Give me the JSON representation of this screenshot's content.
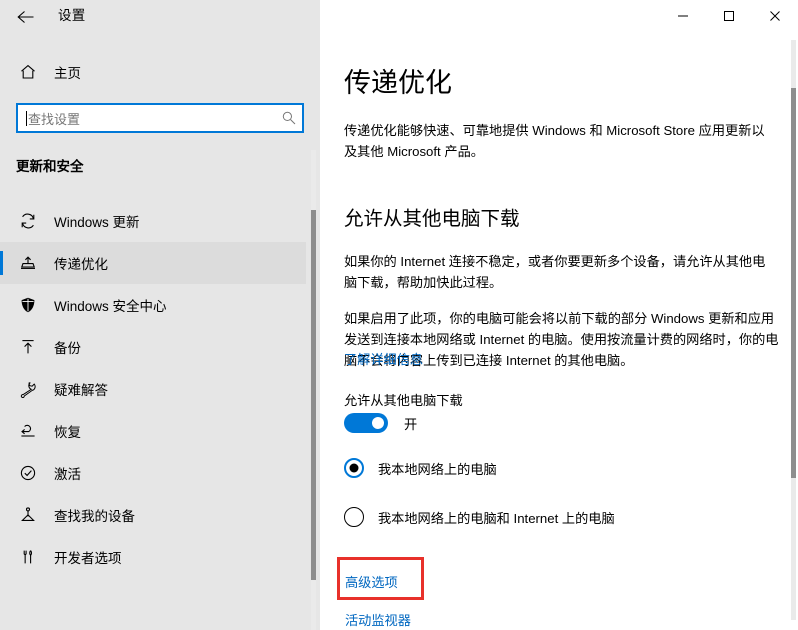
{
  "window": {
    "app_title": "设置",
    "back_icon": "back-arrow-icon",
    "minimize_label": "最小化",
    "maximize_label": "最大化",
    "close_label": "关闭"
  },
  "sidebar": {
    "home": {
      "label": "主页",
      "icon": "home-icon"
    },
    "search": {
      "placeholder": "查找设置",
      "value": "",
      "icon": "search-icon"
    },
    "group_heading": "更新和安全",
    "items": [
      {
        "label": "Windows 更新",
        "icon": "sync-icon",
        "selected": false
      },
      {
        "label": "传递优化",
        "icon": "delivery-optimization-icon",
        "selected": true
      },
      {
        "label": "Windows 安全中心",
        "icon": "shield-icon",
        "selected": false
      },
      {
        "label": "备份",
        "icon": "backup-upload-icon",
        "selected": false
      },
      {
        "label": "疑难解答",
        "icon": "wrench-icon",
        "selected": false
      },
      {
        "label": "恢复",
        "icon": "recovery-icon",
        "selected": false
      },
      {
        "label": "激活",
        "icon": "check-circle-icon",
        "selected": false
      },
      {
        "label": "查找我的设备",
        "icon": "find-device-icon",
        "selected": false
      },
      {
        "label": "开发者选项",
        "icon": "developer-tools-icon",
        "selected": false
      }
    ]
  },
  "main": {
    "page_title": "传递优化",
    "intro": "传递优化能够快速、可靠地提供 Windows 和 Microsoft Store 应用更新以及其他 Microsoft 产品。",
    "section_title": "允许从其他电脑下载",
    "paragraph_1": "如果你的 Internet 连接不稳定，或者你要更新多个设备，请允许从其他电脑下载，帮助加快此过程。",
    "paragraph_2": "如果启用了此项，你的电脑可能会将以前下载的部分 Windows 更新和应用发送到连接本地网络或 Internet 的电脑。使用按流量计费的网络时，你的电脑不会将内容上传到已连接 Internet 的其他电脑。",
    "learn_more_label": "了解详细信息",
    "toggle": {
      "label": "允许从其他电脑下载",
      "state_label": "开",
      "on": true
    },
    "radios": [
      {
        "label": "我本地网络上的电脑",
        "checked": true
      },
      {
        "label": "我本地网络上的电脑和 Internet 上的电脑",
        "checked": false
      }
    ],
    "advanced_options_label": "高级选项",
    "activity_monitor_label": "活动监视器"
  },
  "annotation": {
    "highlight_color": "#e8312a",
    "highlight_target": "高级选项"
  },
  "colors": {
    "accent": "#0078d7",
    "link": "#0067c0",
    "sidebar_bg": "#e6e6e6",
    "content_bg": "#ffffff",
    "highlight": "#e8312a"
  }
}
